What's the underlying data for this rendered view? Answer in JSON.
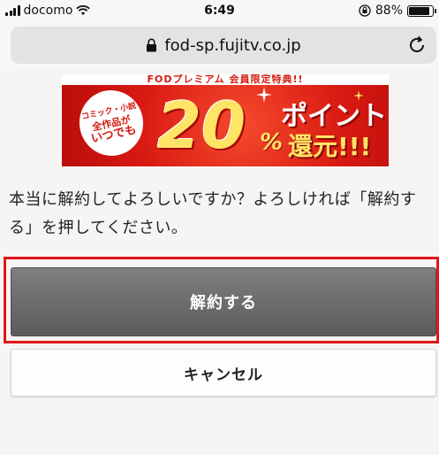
{
  "status_bar": {
    "carrier": "docomo",
    "time": "6:49",
    "battery": "88%",
    "battery_level": 0.88
  },
  "browser": {
    "url": "fod-sp.fujitv.co.jp"
  },
  "banner": {
    "top_strip": "FODプレミアム 会員限定特典!!",
    "badge_line1": "コミック・小説",
    "badge_line2": "全作品が",
    "badge_line3": "いつでも",
    "big_number": "20",
    "percent_sign": "%",
    "point_text": "ポイント",
    "return_text": "還元!!!"
  },
  "message": "本当に解約してよろしいですか？よろしければ「解約する」を押してください。",
  "buttons": {
    "confirm_label": "解約する",
    "cancel_label": "キャンセル"
  },
  "colors": {
    "highlight": "#e0161c",
    "primary_button": "#6b6b6b",
    "banner_red": "#d81a12"
  }
}
